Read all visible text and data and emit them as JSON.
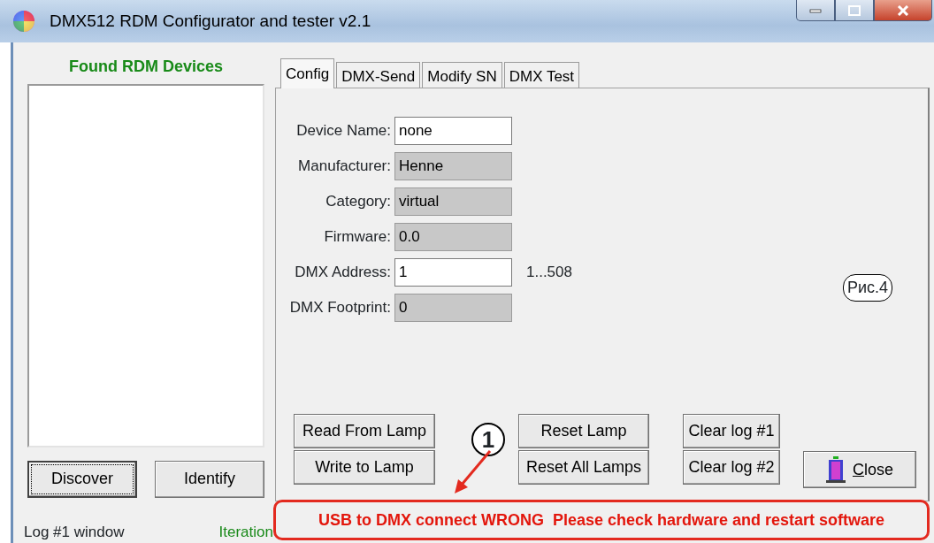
{
  "window": {
    "title": "DMX512 RDM Configurator and tester v2.1"
  },
  "device_list": {
    "title": "Found RDM Devices"
  },
  "left_buttons": [
    {
      "label": "Discover",
      "focused": true
    },
    {
      "label": "Identify",
      "focused": false
    }
  ],
  "log_label": "Log #1 window",
  "iteration_label": "Iteration",
  "tabs": [
    {
      "label": "Config",
      "selected": true
    },
    {
      "label": "DMX-Send",
      "selected": false
    },
    {
      "label": "Modify SN",
      "selected": false
    },
    {
      "label": "DMX Test",
      "selected": false
    }
  ],
  "fields": [
    {
      "label": "Device Name:",
      "value": "none",
      "disabled": false
    },
    {
      "label": "Manufacturer:",
      "value": "Henne",
      "disabled": true
    },
    {
      "label": "Category:",
      "value": "virtual",
      "disabled": true
    },
    {
      "label": "Firmware:",
      "value": "0.0",
      "disabled": true
    },
    {
      "label": "DMX Address:",
      "value": "1",
      "disabled": false,
      "hint": "1...508"
    },
    {
      "label": "DMX Footprint:",
      "value": "0",
      "disabled": true
    }
  ],
  "button_groups": [
    [
      "Read From Lamp",
      "Write to Lamp"
    ],
    [
      "Reset Lamp",
      "Reset All Lamps"
    ],
    [
      "Clear log #1",
      "Clear log #2"
    ]
  ],
  "close_button": {
    "label": "Close"
  },
  "status_message": "USB to DMX connect WRONG  Please check hardware and restart software",
  "annotations": {
    "figure_label": "Рис.4",
    "callout": "1"
  }
}
